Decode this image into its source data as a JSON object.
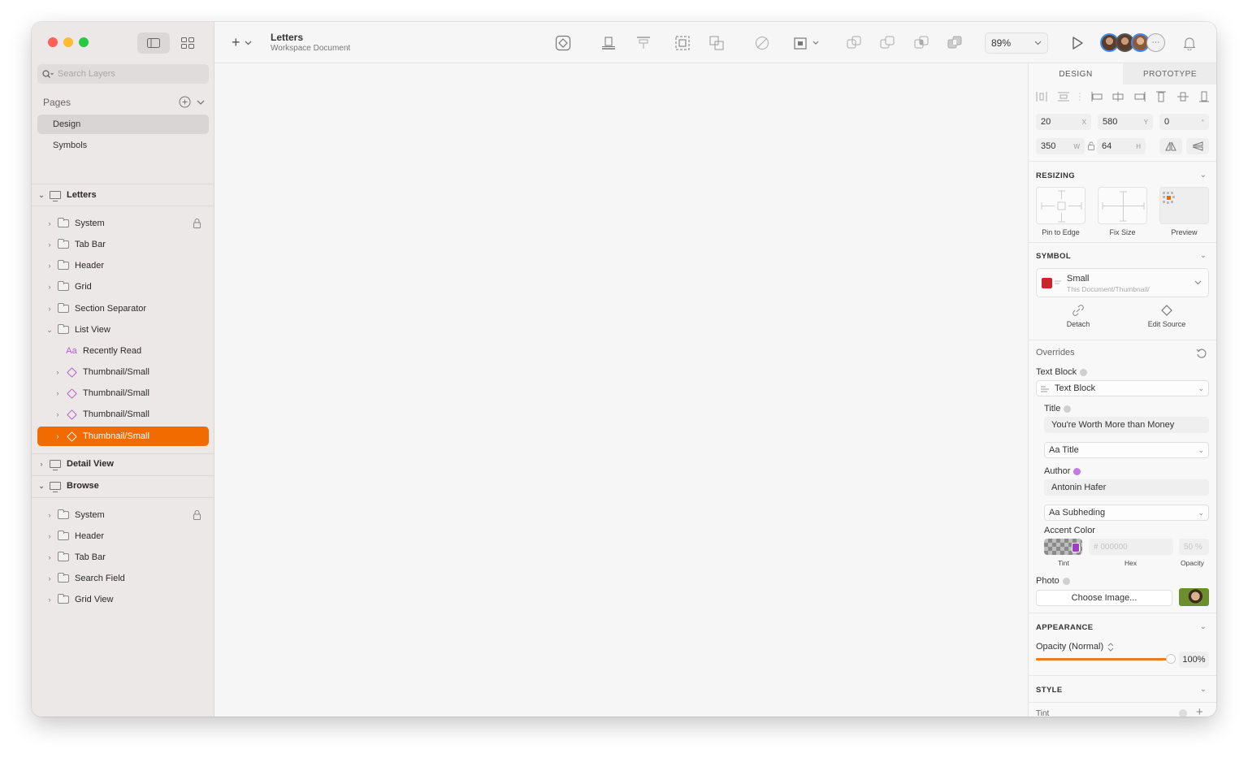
{
  "sidebar": {
    "search_placeholder": "Search Layers",
    "pages_label": "Pages",
    "pages": [
      "Design",
      "Symbols"
    ],
    "artboards": {
      "letters": "Letters",
      "letters_children": [
        "System",
        "Tab Bar",
        "Header",
        "Grid",
        "Section Separator",
        "List View"
      ],
      "list_view_children": [
        "Recently Read",
        "Thumbnail/Small",
        "Thumbnail/Small",
        "Thumbnail/Small",
        "Thumbnail/Small"
      ],
      "detail_view": "Detail View",
      "browse": "Browse",
      "browse_children": [
        "System",
        "Header",
        "Tab Bar",
        "Search Field",
        "Grid View"
      ]
    }
  },
  "toolbar": {
    "doc_title": "Letters",
    "doc_subtitle": "Workspace Document",
    "zoom": "89%"
  },
  "inspector": {
    "tab_design": "DESIGN",
    "tab_prototype": "PROTOTYPE",
    "x": "20",
    "x_label": "X",
    "y": "580",
    "y_label": "Y",
    "rotation": "0",
    "rotation_label": "°",
    "w": "350",
    "w_label": "W",
    "h": "64",
    "h_label": "H",
    "resizing": {
      "title": "RESIZING",
      "pin_to_edge": "Pin to Edge",
      "fix_size": "Fix Size",
      "preview": "Preview"
    },
    "symbol": {
      "title": "SYMBOL",
      "name": "Small",
      "source": "This Document/Thumbnail/",
      "detach": "Detach",
      "edit_source": "Edit Source",
      "color": "#c8262a"
    },
    "overrides": {
      "title": "Overrides",
      "text_block_label": "Text Block",
      "text_block_value": "Text Block",
      "title_label": "Title",
      "title_value": "You're Worth More than Money",
      "title_style": "Aa Title",
      "author_label": "Author",
      "author_value": "Antonin Hafer",
      "author_style": "Aa Subheding",
      "accent_label": "Accent Color",
      "hex_placeholder": "# 000000",
      "opacity_placeholder": "50 %",
      "tint_label": "Tint",
      "hex_label": "Hex",
      "opacity_label": "Opacity",
      "photo_label": "Photo",
      "choose_image": "Choose Image..."
    },
    "appearance": {
      "title": "APPEARANCE",
      "opacity_mode": "Opacity (Normal)",
      "opacity_value": "100%",
      "opacity_fraction": 1.0,
      "accent": "#f07a1c"
    },
    "style": {
      "title": "STYLE",
      "tint": "Tint"
    }
  },
  "colors": {
    "selection": "#f26b00",
    "symbol_purple": "#b45cd6"
  }
}
